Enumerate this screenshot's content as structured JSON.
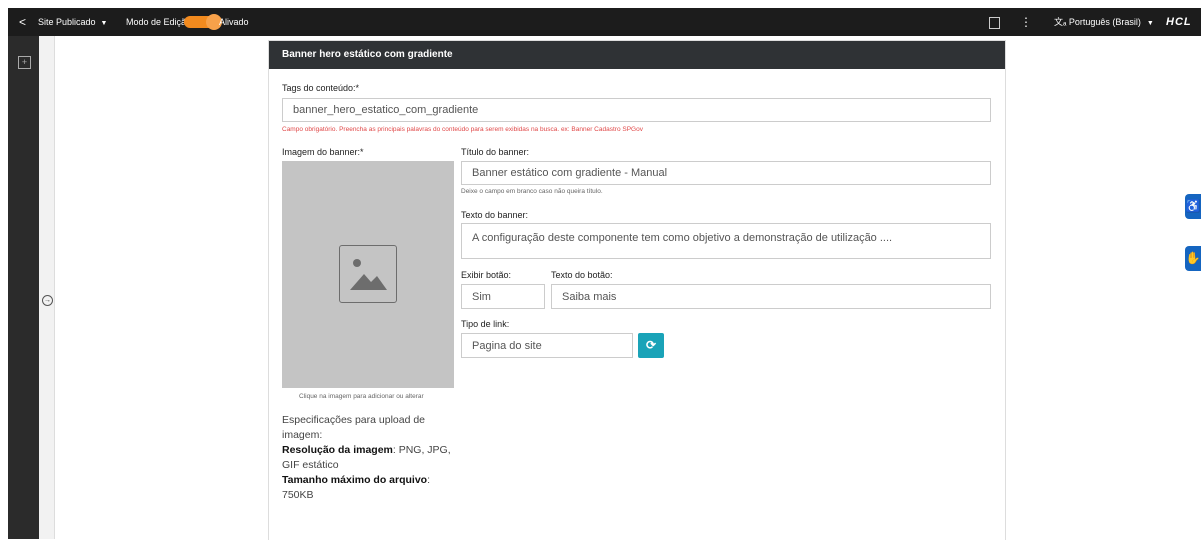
{
  "topbar": {
    "back_icon": "chevron-left-icon",
    "site_status": "Site Publicado",
    "mode_label": "Modo de Edição:",
    "mode_state": "Alivado",
    "mode_on": true,
    "toggle_color": "#f28a1e",
    "panel_icon": "panel-icon",
    "kebab_icon": "kebab-menu-icon",
    "language_icon": "translate-icon",
    "language": "Português (Brasil)",
    "logo": "HCL"
  },
  "dialog": {
    "title": "Banner hero estático com gradiente",
    "tags_label": "Tags do conteúdo:*",
    "tags_value": "banner_hero_estatico_com_gradiente",
    "tags_error": "Campo obrigatório. Preencha as principais palavras do conteúdo para serem exibidas na busca. ex: Banner Cadastro SPGov",
    "image_label": "Imagem do banner:*",
    "image_hint": "Clique na imagem para adicionar ou alterar",
    "title_label": "Título do banner:",
    "title_value": "Banner estático com gradiente - Manual",
    "title_hint": "Deixe o campo em branco caso não queira título.",
    "text_label": "Texto do banner:",
    "text_value": "A configuração deste componente tem como objetivo a demonstração de utilização ....",
    "show_button_label": "Exibir botão:",
    "show_button_value": "Sim",
    "button_text_label": "Texto do botão:",
    "button_text_value": "Saiba mais",
    "link_type_label": "Tipo de link:",
    "link_type_value": "Pagina do site",
    "specs_title": "Especificações para upload de imagem:",
    "specs_resolution_label": "Resolução da imagem",
    "specs_resolution_value": ": PNG, JPG, GIF estático",
    "specs_size_label": "Tamanho máximo do arquivo",
    "specs_size_value": ": 750KB"
  },
  "colors": {
    "header_bg": "#2f3235",
    "error": "#e04848",
    "refresh_button": "#1aa3b8",
    "side_buttons": "#1565c0"
  }
}
